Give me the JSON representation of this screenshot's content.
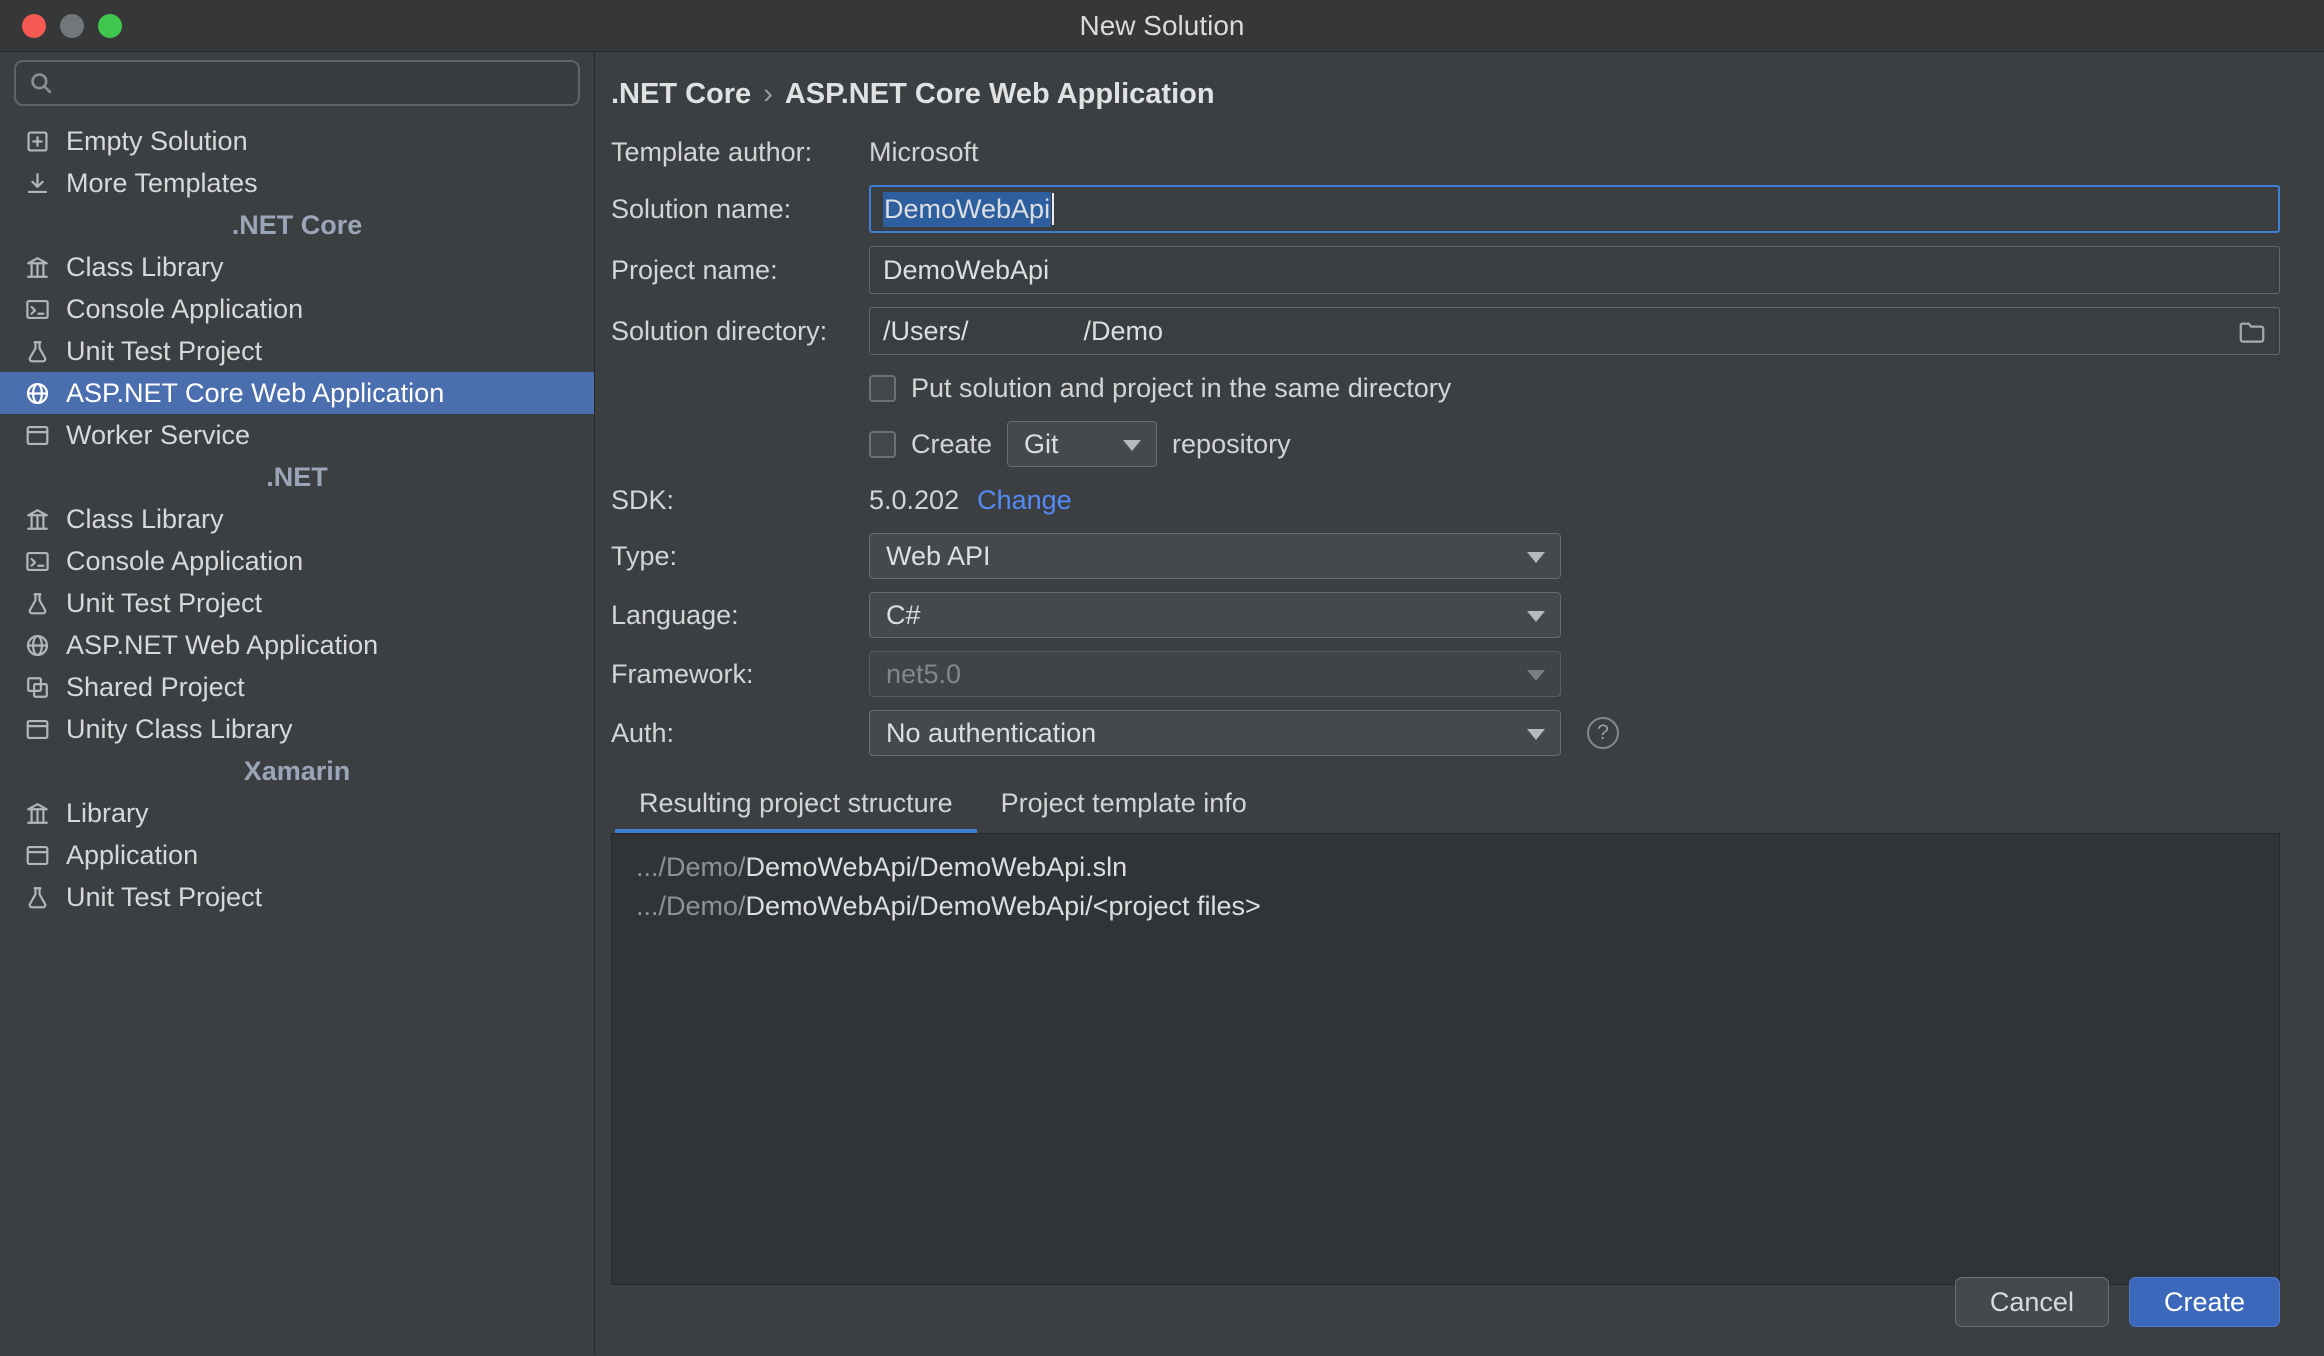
{
  "window": {
    "title": "New Solution"
  },
  "sidebar": {
    "items": [
      {
        "type": "item",
        "icon": "empty-solution-icon",
        "label": "Empty Solution"
      },
      {
        "type": "item",
        "icon": "more-templates-icon",
        "label": "More Templates"
      },
      {
        "type": "header",
        "label": ".NET Core"
      },
      {
        "type": "item",
        "icon": "class-library-icon",
        "label": "Class Library"
      },
      {
        "type": "item",
        "icon": "console-application-icon",
        "label": "Console Application"
      },
      {
        "type": "item",
        "icon": "unit-test-icon",
        "label": "Unit Test Project"
      },
      {
        "type": "item",
        "icon": "web-application-icon",
        "label": "ASP.NET Core Web Application",
        "selected": true
      },
      {
        "type": "item",
        "icon": "worker-service-icon",
        "label": "Worker Service"
      },
      {
        "type": "header",
        "label": ".NET"
      },
      {
        "type": "item",
        "icon": "class-library-icon",
        "label": "Class Library"
      },
      {
        "type": "item",
        "icon": "console-application-icon",
        "label": "Console Application"
      },
      {
        "type": "item",
        "icon": "unit-test-icon",
        "label": "Unit Test Project"
      },
      {
        "type": "item",
        "icon": "web-application-icon",
        "label": "ASP.NET Web Application"
      },
      {
        "type": "item",
        "icon": "shared-project-icon",
        "label": "Shared Project"
      },
      {
        "type": "item",
        "icon": "unity-class-library-icon",
        "label": "Unity Class Library"
      },
      {
        "type": "header",
        "label": "Xamarin"
      },
      {
        "type": "item",
        "icon": "library-icon",
        "label": "Library"
      },
      {
        "type": "item",
        "icon": "application-icon",
        "label": "Application"
      },
      {
        "type": "item",
        "icon": "unit-test-icon",
        "label": "Unit Test Project"
      }
    ]
  },
  "breadcrumb": {
    "parts": [
      ".NET Core",
      "ASP.NET Core Web Application"
    ],
    "separator": "›"
  },
  "form": {
    "template_author_label": "Template author:",
    "template_author_value": "Microsoft",
    "solution_name_label": "Solution name:",
    "solution_name_value": "DemoWebApi",
    "project_name_label": "Project name:",
    "project_name_value": "DemoWebApi",
    "solution_directory_label": "Solution directory:",
    "solution_directory_prefix": "/Users/",
    "solution_directory_suffix": "/Demo",
    "same_directory_checkbox_label": "Put solution and project in the same directory",
    "create_checkbox_label": "Create",
    "vcs_value": "Git",
    "repository_label": "repository",
    "sdk_label": "SDK:",
    "sdk_value": "5.0.202",
    "sdk_change_link": "Change",
    "type_label": "Type:",
    "type_value": "Web API",
    "language_label": "Language:",
    "language_value": "C#",
    "framework_label": "Framework:",
    "framework_value": "net5.0",
    "auth_label": "Auth:",
    "auth_value": "No authentication",
    "help_glyph": "?"
  },
  "tabs": [
    {
      "label": "Resulting project structure",
      "active": true
    },
    {
      "label": "Project template info",
      "active": false
    }
  ],
  "preview": {
    "lines": [
      {
        "muted": ".../Demo/",
        "strong": "DemoWebApi/DemoWebApi.sln"
      },
      {
        "muted": ".../Demo/",
        "strong": "DemoWebApi/DemoWebApi/<project files>"
      }
    ]
  },
  "footer": {
    "cancel_label": "Cancel",
    "create_label": "Create"
  },
  "colors": {
    "selection": "#4b6eaf",
    "focus": "#3e7fd6",
    "link": "#548af7",
    "create-bg": "#3c68bb",
    "window-bg": "#3c3f41",
    "preview-bg": "#313436"
  }
}
